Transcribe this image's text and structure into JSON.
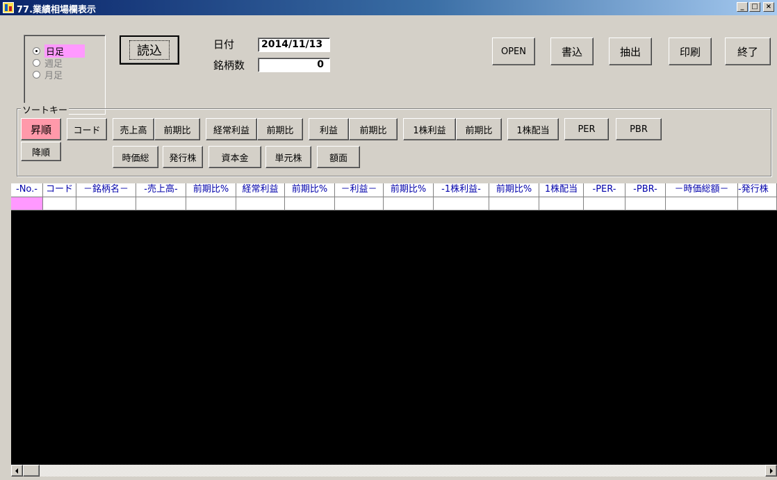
{
  "window": {
    "title": "77.業績相場欄表示",
    "controls": [
      "_",
      "□",
      "×"
    ]
  },
  "period": {
    "options": [
      {
        "label": "日足",
        "selected": true
      },
      {
        "label": "週足",
        "selected": false
      },
      {
        "label": "月足",
        "selected": false
      }
    ]
  },
  "toolbar": {
    "read_label": "読込",
    "date_label": "日付",
    "date_value": "2014/11/13",
    "count_label": "銘柄数",
    "count_value": "0",
    "open_label": "OPEN",
    "write_label": "書込",
    "extract_label": "抽出",
    "print_label": "印刷",
    "exit_label": "終了"
  },
  "sort": {
    "title": "ソートキー",
    "asc_label": "昇順",
    "desc_label": "降順",
    "row1": [
      "コード",
      "売上高",
      "前期比",
      "経常利益",
      "前期比",
      "利益",
      "前期比",
      "1株利益",
      "前期比",
      "1株配当",
      "PER",
      "PBR"
    ],
    "row2": [
      "時価総",
      "発行株",
      "資本金",
      "単元株",
      "額面"
    ]
  },
  "grid": {
    "columns": [
      "-No.-",
      "コード",
      "－銘柄名－",
      "-売上高-",
      "前期比%",
      "経常利益",
      "前期比%",
      "－利益－",
      "前期比%",
      "-1株利益-",
      "前期比%",
      "1株配当",
      "-PER-",
      "-PBR-",
      "－時価総額－",
      "-発行株"
    ]
  },
  "colors": {
    "title_start": "#0a246a",
    "title_end": "#a6caf0",
    "highlight": "#ff99ff",
    "asc_button": "#ff99aa",
    "grid_background": "#000000",
    "grid_header_text": "#0000aa"
  },
  "icons": [
    "app-icon",
    "scroll-left-icon",
    "scroll-right-icon"
  ]
}
